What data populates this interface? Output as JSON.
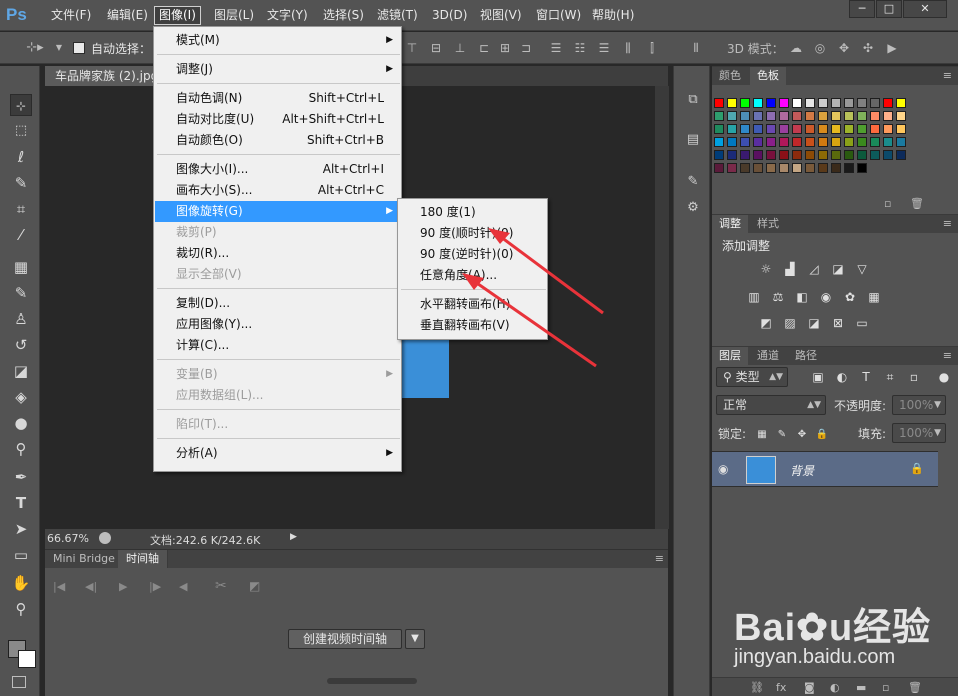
{
  "app": {
    "logo": "Ps"
  },
  "menubar": {
    "items": [
      "文件(F)",
      "编辑(E)",
      "图像(I)",
      "图层(L)",
      "文字(Y)",
      "选择(S)",
      "滤镜(T)",
      "3D(D)",
      "视图(V)",
      "窗口(W)",
      "帮助(H)"
    ],
    "active_index": 2
  },
  "options": {
    "auto_select_label": "自动选择：",
    "mode_3d_label": "3D 模式："
  },
  "document": {
    "tab_title": "车品牌家族 (2).jpg",
    "zoom": "66.67%",
    "doc_info": "文档:242.6 K/242.6K",
    "image_color": "#3a8fd8"
  },
  "timeline": {
    "tabs": [
      "Mini Bridge",
      "时间轴"
    ],
    "active_index": 1,
    "create_button": "创建视频时间轴"
  },
  "image_menu": {
    "items": [
      {
        "label": "模式(M)",
        "submenu": true
      },
      {
        "sep": true
      },
      {
        "label": "调整(J)",
        "submenu": true
      },
      {
        "sep": true
      },
      {
        "label": "自动色调(N)",
        "shortcut": "Shift+Ctrl+L"
      },
      {
        "label": "自动对比度(U)",
        "shortcut": "Alt+Shift+Ctrl+L"
      },
      {
        "label": "自动颜色(O)",
        "shortcut": "Shift+Ctrl+B"
      },
      {
        "sep": true
      },
      {
        "label": "图像大小(I)...",
        "shortcut": "Alt+Ctrl+I"
      },
      {
        "label": "画布大小(S)...",
        "shortcut": "Alt+Ctrl+C"
      },
      {
        "label": "图像旋转(G)",
        "submenu": true,
        "highlighted": true
      },
      {
        "label": "裁剪(P)",
        "disabled": true
      },
      {
        "label": "裁切(R)..."
      },
      {
        "label": "显示全部(V)",
        "disabled": true
      },
      {
        "sep": true
      },
      {
        "label": "复制(D)..."
      },
      {
        "label": "应用图像(Y)..."
      },
      {
        "label": "计算(C)..."
      },
      {
        "sep": true
      },
      {
        "label": "变量(B)",
        "submenu": true,
        "disabled": true
      },
      {
        "label": "应用数据组(L)...",
        "disabled": true
      },
      {
        "sep": true
      },
      {
        "label": "陷印(T)...",
        "disabled": true
      },
      {
        "sep": true
      },
      {
        "label": "分析(A)",
        "submenu": true
      }
    ]
  },
  "rotate_menu": {
    "items": [
      {
        "label": "180 度(1)"
      },
      {
        "label": "90 度(顺时针)(9)"
      },
      {
        "label": "90 度(逆时针)(0)"
      },
      {
        "label": "任意角度(A)..."
      },
      {
        "sep": true
      },
      {
        "label": "水平翻转画布(H)"
      },
      {
        "label": "垂直翻转画布(V)"
      }
    ]
  },
  "panels": {
    "color": {
      "tabs": [
        "颜色",
        "色板"
      ],
      "active_index": 1
    },
    "adjust": {
      "tabs": [
        "调整",
        "样式"
      ],
      "active_index": 0,
      "title": "添加调整"
    },
    "layers": {
      "tabs": [
        "图层",
        "通道",
        "路径"
      ],
      "active_index": 0,
      "filter_kind": "类型",
      "blend_mode": "正常",
      "opacity_label": "不透明度:",
      "opacity_value": "100%",
      "lock_label": "锁定:",
      "fill_label": "填充:",
      "fill_value": "100%",
      "layer_name": "背景"
    }
  },
  "swatches": {
    "rows": [
      [
        "#ff0000",
        "#ffff00",
        "#00ff00",
        "#00ffff",
        "#0000ff",
        "#ff00ff",
        "#ffffff",
        "#e6e6e6",
        "#cccccc",
        "#b3b3b3",
        "#999999",
        "#808080",
        "#666666",
        "#ff0000",
        "#ffff00"
      ],
      [
        "#2e9e6e",
        "#4fa7b0",
        "#4d8fb8",
        "#6a73b3",
        "#8d6db0",
        "#b06a9e",
        "#c35a5a",
        "#d37a45",
        "#d9a13d",
        "#e5c65c",
        "#b8c25a",
        "#7fb25a",
        "#ff8c66",
        "#ffb08a",
        "#ffd58a"
      ],
      [
        "#1f8a5e",
        "#27a3a7",
        "#2f88c9",
        "#3f5bb4",
        "#6a48b0",
        "#9a3f9e",
        "#c23b4f",
        "#cc5a2a",
        "#d88b1c",
        "#e6b81e",
        "#9db32a",
        "#4f9e2f",
        "#ff6a3d",
        "#ff9a5c",
        "#ffc65c"
      ],
      [
        "#00a0e0",
        "#0078c0",
        "#3d4fb0",
        "#5a2ea0",
        "#8a1f8a",
        "#b0185a",
        "#c0282a",
        "#c8501a",
        "#d07a10",
        "#d8a410",
        "#8aa018",
        "#3a8a1e",
        "#198a5a",
        "#1a8c8c",
        "#1a7aa0"
      ],
      [
        "#003c78",
        "#1a2a78",
        "#3a1a70",
        "#5a1060",
        "#78103c",
        "#8c1018",
        "#8c2a0c",
        "#8c4a06",
        "#8c6a06",
        "#5a6a0c",
        "#2a5a10",
        "#0c5a3c",
        "#0c5a5a",
        "#0c4a6a",
        "#0c2a5a"
      ],
      [
        "#5a1a3a",
        "#7a2a4a",
        "#4a3a2a",
        "#6a5038",
        "#8a6a4a",
        "#a8886a",
        "#c4a684",
        "#7a5a3a",
        "#5a3a1a",
        "#3a2a1a",
        "#1a1a1a",
        "#000000"
      ]
    ]
  }
}
